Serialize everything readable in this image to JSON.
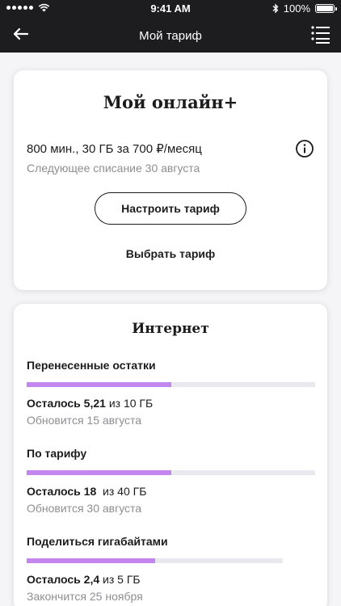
{
  "status_bar": {
    "time": "9:41 AM",
    "battery": "100%"
  },
  "header": {
    "title": "Мой тариф"
  },
  "plan": {
    "name": "Мой онлайн+",
    "price_line": "800 мин., 30 ГБ за 700 ₽/месяц",
    "next_charge": "Следующее списание 30 августа",
    "configure_button": "Настроить тариф",
    "choose_button": "Выбрать тариф"
  },
  "internet": {
    "title": "Интернет",
    "items": [
      {
        "label": "Перенесенные остатки",
        "remain_prefix": "Осталось 5,21",
        "remain_suffix": " из 10 ГБ",
        "note": "Обновится 15 августа",
        "progress": 0.5
      },
      {
        "label": "По тарифу",
        "remain_prefix": "Осталось 18",
        "remain_suffix": "  из 40 ГБ",
        "note": "Обновится 30 августа",
        "progress": 0.5
      },
      {
        "label": "Поделиться гигабайтами",
        "remain_prefix": "Осталось 2,4",
        "remain_suffix": " из 5 ГБ",
        "note": "Закончится 25 ноября",
        "progress": 0.5
      }
    ]
  },
  "colors": {
    "accent": "#c286ee",
    "header_bg": "#1d1d1f",
    "track": "#e8e8ee"
  }
}
